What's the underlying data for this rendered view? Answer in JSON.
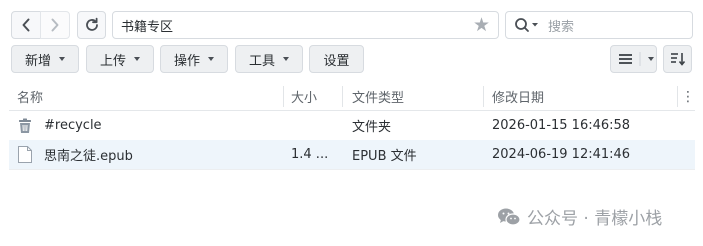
{
  "nav": {
    "back_icon": "chevron-left-icon",
    "forward_icon": "chevron-right-icon",
    "refresh_icon": "refresh-icon"
  },
  "path": {
    "value": "书籍专区",
    "favorite_icon": "star-icon"
  },
  "search": {
    "placeholder": "搜索",
    "icon": "search-icon"
  },
  "toolbar": {
    "buttons": [
      {
        "label": "新增",
        "dropdown": true
      },
      {
        "label": "上传",
        "dropdown": true
      },
      {
        "label": "操作",
        "dropdown": true
      },
      {
        "label": "工具",
        "dropdown": true
      },
      {
        "label": "设置",
        "dropdown": false
      }
    ],
    "view_icon": "list-view-icon",
    "sort_icon": "sort-icon"
  },
  "table": {
    "columns": [
      "名称",
      "大小",
      "文件类型",
      "修改日期"
    ],
    "rows": [
      {
        "icon": "recycle-bin-icon",
        "name": "#recycle",
        "size": "",
        "type": "文件夹",
        "modified": "2026-01-15 16:46:58",
        "selected": false
      },
      {
        "icon": "file-icon",
        "name": "思南之徒.epub",
        "size": "1.4 ...",
        "type": "EPUB 文件",
        "modified": "2024-06-19 12:41:46",
        "selected": true
      }
    ]
  },
  "watermark": {
    "text": "公众号 · 青檬小栈",
    "icon": "wechat-icon"
  },
  "colors": {
    "selected_row": "#eef5fb",
    "border": "#d7dbe0",
    "toolbar_bg": "#eef0f2"
  }
}
